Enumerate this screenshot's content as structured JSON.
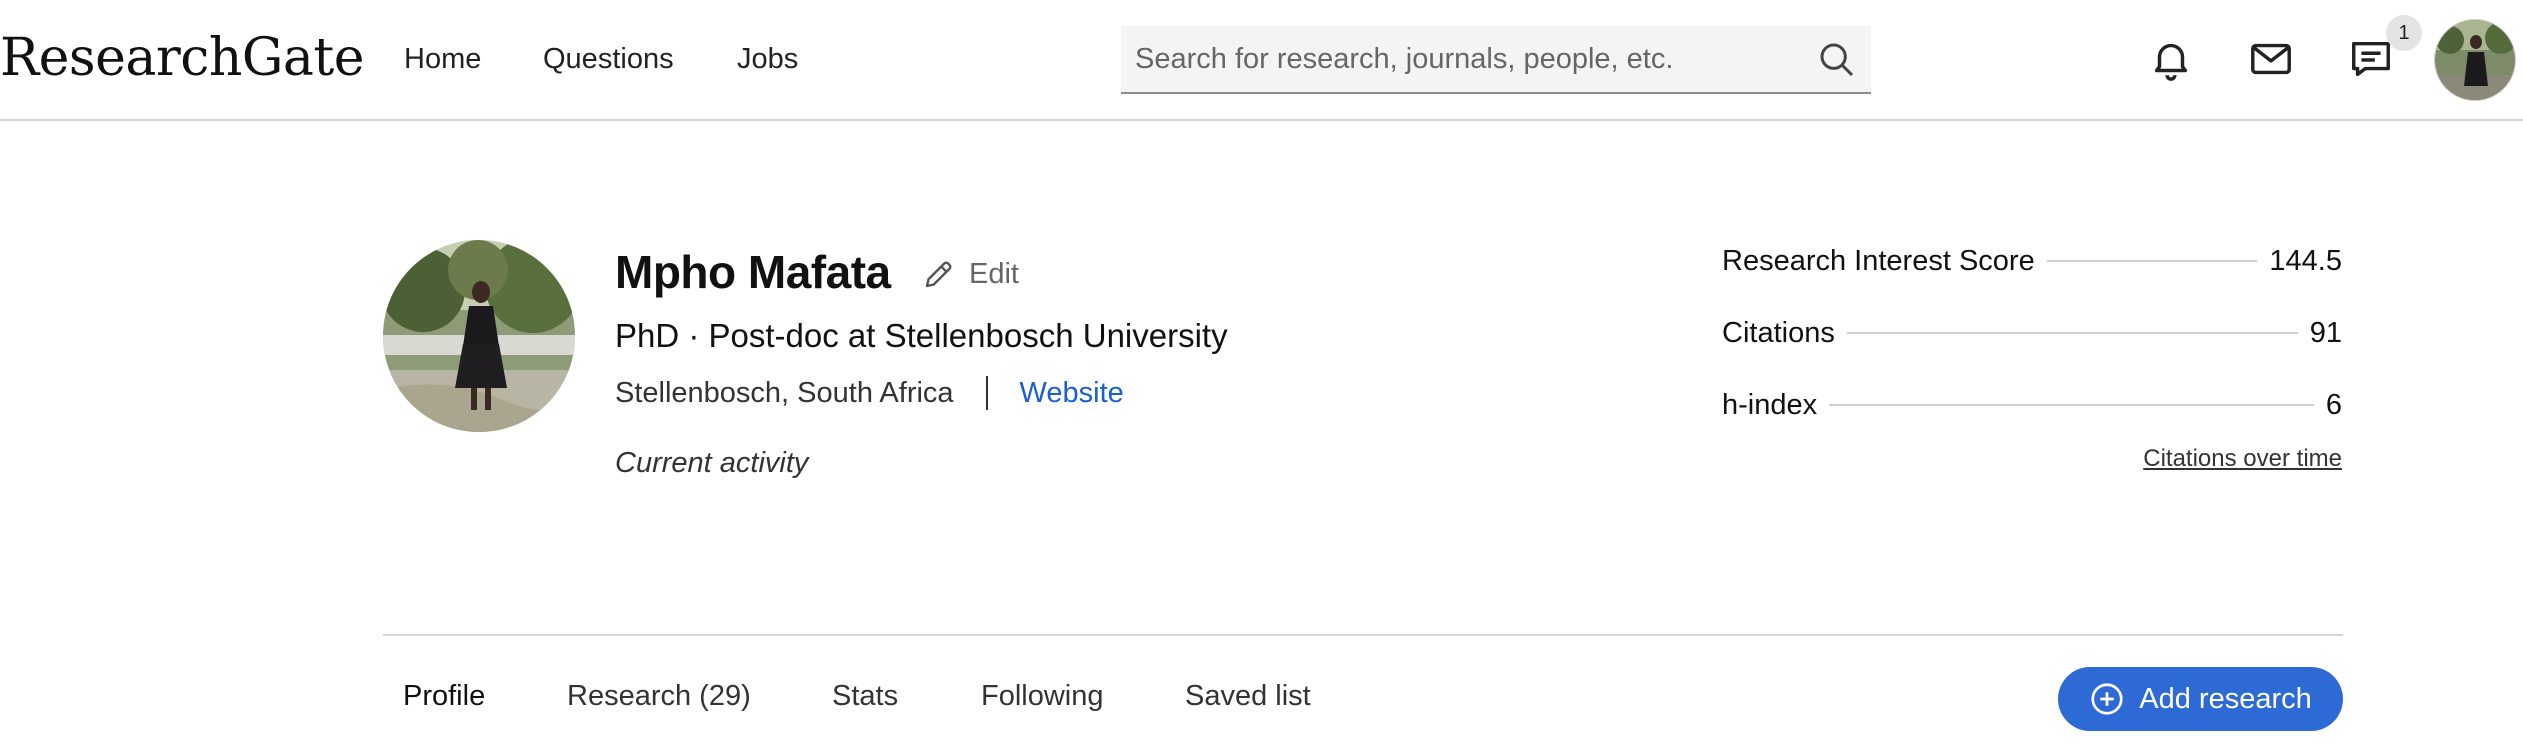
{
  "topbar": {
    "logo": "ResearchGate",
    "nav": {
      "home": "Home",
      "questions": "Questions",
      "jobs": "Jobs"
    },
    "search_placeholder": "Search for research, journals, people, etc.",
    "notification_badge": "1"
  },
  "profile": {
    "name": "Mpho Mafata",
    "edit_label": "Edit",
    "degree_position": "PhD · Post-doc at Stellenbosch University",
    "location": "Stellenbosch, South Africa",
    "website_label": "Website",
    "current_activity": "Current activity"
  },
  "stats": {
    "research_interest_label": "Research Interest Score",
    "research_interest_value": "144.5",
    "citations_label": "Citations",
    "citations_value": "91",
    "h_index_label": "h-index",
    "h_index_value": "6",
    "citations_over_time": "Citations over time"
  },
  "tabs": {
    "profile": "Profile",
    "research": "Research (29)",
    "stats": "Stats",
    "following": "Following",
    "saved": "Saved list"
  },
  "add_research_label": "Add research",
  "colors": {
    "accent": "#2e6ad6",
    "link": "#1a5fd0",
    "divider": "#d6d6d6"
  },
  "icons": [
    "search-icon",
    "bell-icon",
    "mail-icon",
    "chat-icon",
    "pencil-icon",
    "plus-circle-icon"
  ]
}
